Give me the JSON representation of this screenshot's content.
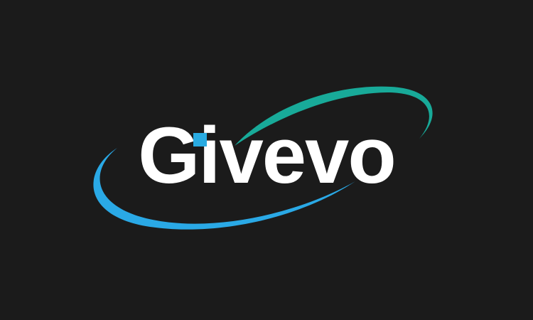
{
  "logo": {
    "wordmark": "Givevo",
    "colors": {
      "background": "#1b1b1b",
      "text": "#ffffff",
      "accent_square": "#29abe2",
      "swoosh_teal": "#17a99a",
      "swoosh_blue": "#29abe2"
    }
  }
}
